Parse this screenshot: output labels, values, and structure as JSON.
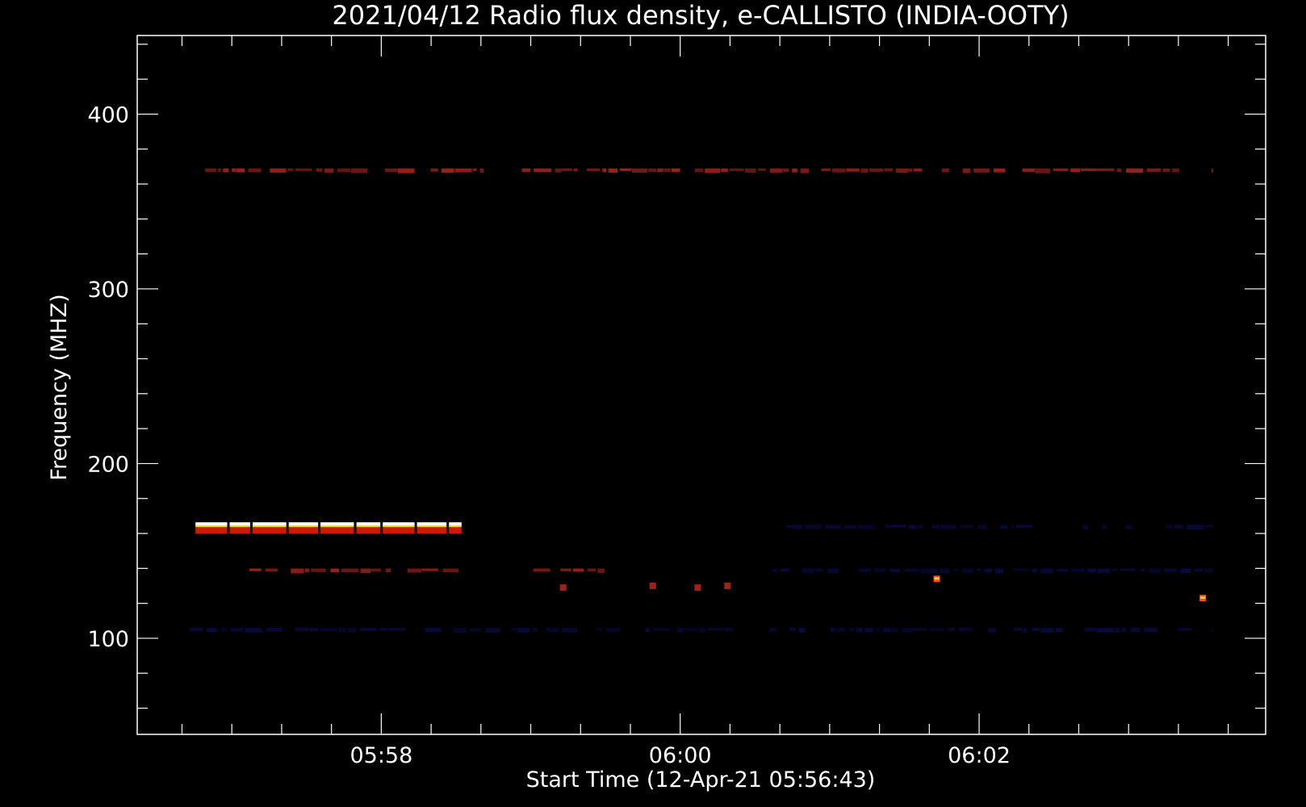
{
  "chart_data": {
    "type": "heatmap",
    "title": "2021/04/12  Radio flux density, e-CALLISTO (INDIA-OOTY)",
    "xlabel": "Start Time (12-Apr-21 05:56:43)",
    "ylabel": "Frequency (MHZ)",
    "x_tick_labels": [
      "05:58",
      "06:00",
      "06:02"
    ],
    "x_tick_minutes": [
      1.283,
      3.283,
      5.283
    ],
    "x_range_minutes": [
      -0.35,
      7.2
    ],
    "data_range_minutes": [
      0.0,
      6.85
    ],
    "y_ticks": [
      100,
      200,
      300,
      400
    ],
    "y_range": [
      445,
      45
    ],
    "data_y_range": [
      445,
      45
    ],
    "colormap": "blue-red-yellow-white",
    "background_color": "#1a1aef",
    "axis_color": "#ffffff",
    "features": [
      {
        "kind": "band",
        "freq": 105,
        "t_start": 0.0,
        "t_end": 6.85,
        "level": "low"
      },
      {
        "kind": "band",
        "freq": 139,
        "t_start": 0.4,
        "t_end": 1.8,
        "level": "mid"
      },
      {
        "kind": "band",
        "freq": 139,
        "t_start": 2.3,
        "t_end": 2.8,
        "level": "mid"
      },
      {
        "kind": "band",
        "freq": 139,
        "t_start": 3.9,
        "t_end": 6.85,
        "level": "low"
      },
      {
        "kind": "band",
        "freq": 165,
        "t_start": 0.04,
        "t_end": 1.82,
        "level": "max"
      },
      {
        "kind": "band",
        "freq": 164,
        "t_start": 3.9,
        "t_end": 6.85,
        "level": "low"
      },
      {
        "kind": "band",
        "freq": 368,
        "t_start": 0.0,
        "t_end": 6.85,
        "level": "mid"
      },
      {
        "kind": "spot",
        "freq": 134,
        "t": 5.0,
        "level": "high"
      },
      {
        "kind": "spot",
        "freq": 123,
        "t": 6.78,
        "level": "high"
      },
      {
        "kind": "spot",
        "freq": 129,
        "t": 2.5,
        "level": "mid"
      },
      {
        "kind": "spot",
        "freq": 130,
        "t": 3.1,
        "level": "mid"
      },
      {
        "kind": "spot",
        "freq": 129,
        "t": 3.4,
        "level": "mid"
      },
      {
        "kind": "spot",
        "freq": 130,
        "t": 3.6,
        "level": "mid"
      }
    ]
  }
}
